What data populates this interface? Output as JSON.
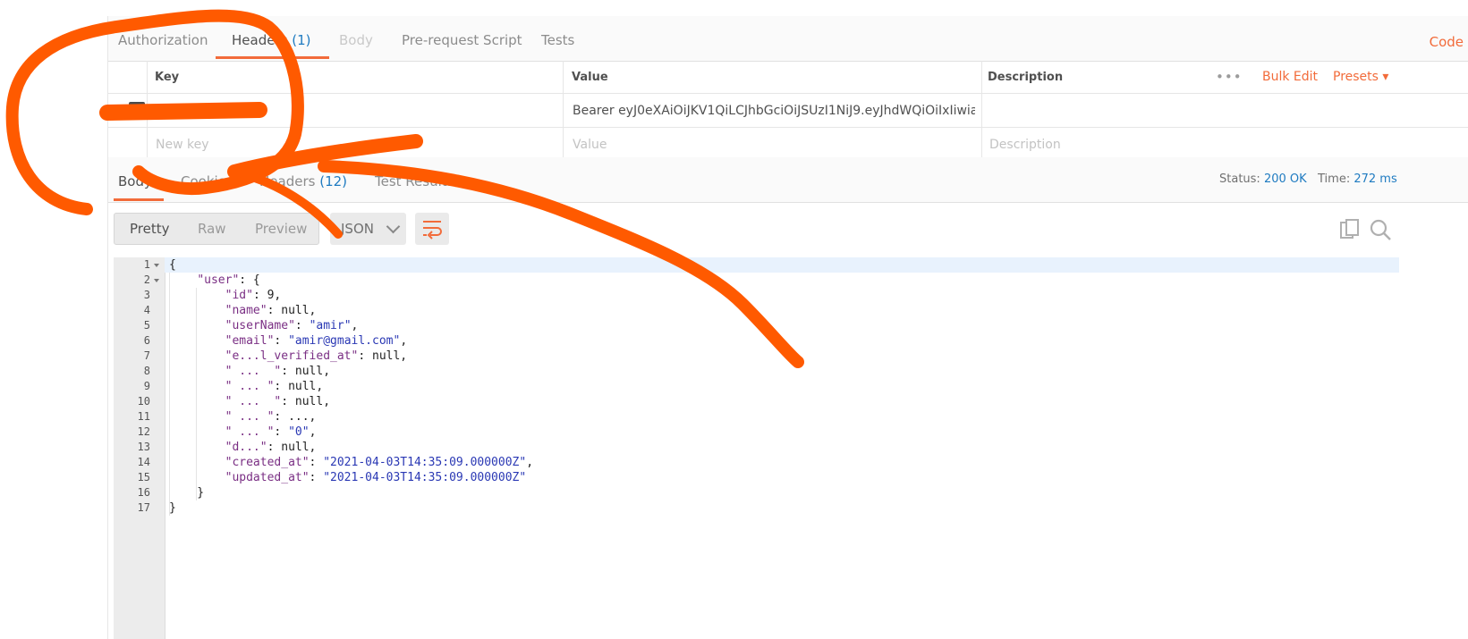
{
  "request_tabs": [
    {
      "label": "Authorization"
    },
    {
      "label": "Headers",
      "count": "(1)"
    },
    {
      "label": "Body"
    },
    {
      "label": "Pre-request Script"
    },
    {
      "label": "Tests"
    }
  ],
  "code_link": "Code",
  "headers_table": {
    "columns": {
      "key": "Key",
      "value": "Value",
      "description": "Description"
    },
    "more_menu": "•••",
    "bulk_edit": "Bulk Edit",
    "presets": "Presets ▾",
    "rows": [
      {
        "key": "Authorization",
        "value": "Bearer eyJ0eXAiOiJKV1QiLCJhbGciOiJSUzI1NiJ9.eyJhdWQiOiIxIiwia...",
        "description": "",
        "checked": true
      }
    ],
    "new_row": {
      "key_placeholder": "New key",
      "value_placeholder": "Value",
      "description_placeholder": "Description"
    }
  },
  "response_tabs": [
    {
      "label": "Body"
    },
    {
      "label": "Cookies"
    },
    {
      "label": "Headers",
      "count": "(12)"
    },
    {
      "label": "Test Results"
    }
  ],
  "status": {
    "status_label": "Status:",
    "status_value": "200 OK",
    "time_label": "Time:",
    "time_value": "272 ms"
  },
  "view_modes": [
    "Pretty",
    "Raw",
    "Preview"
  ],
  "format": "JSON",
  "icons": {
    "wrap": "wrap-lines-icon",
    "copy": "copy-icon",
    "search": "search-icon"
  },
  "colors": {
    "accent": "#f26b3a",
    "link_blue": "#1f7bc1",
    "scribble": "#ff5a00"
  },
  "code": {
    "line_numbers": [
      "1",
      "2",
      "3",
      "4",
      "5",
      "6",
      "7",
      "8",
      "9",
      "10",
      "11",
      "12",
      "13",
      "14",
      "15",
      "16",
      "17"
    ],
    "lines": [
      [
        {
          "t": "n",
          "v": "{"
        }
      ],
      [
        {
          "t": "n",
          "v": "    "
        },
        {
          "t": "k",
          "v": "\"user\""
        },
        {
          "t": "n",
          "v": ": {"
        }
      ],
      [
        {
          "t": "n",
          "v": "        "
        },
        {
          "t": "k",
          "v": "\"id\""
        },
        {
          "t": "n",
          "v": ": 9,"
        }
      ],
      [
        {
          "t": "n",
          "v": "        "
        },
        {
          "t": "k",
          "v": "\"name\""
        },
        {
          "t": "n",
          "v": ": null,"
        }
      ],
      [
        {
          "t": "n",
          "v": "        "
        },
        {
          "t": "k",
          "v": "\"userName\""
        },
        {
          "t": "n",
          "v": ": "
        },
        {
          "t": "s",
          "v": "\"amir\""
        },
        {
          "t": "n",
          "v": ","
        }
      ],
      [
        {
          "t": "n",
          "v": "        "
        },
        {
          "t": "k",
          "v": "\"email\""
        },
        {
          "t": "n",
          "v": ": "
        },
        {
          "t": "s",
          "v": "\"amir@gmail.com\""
        },
        {
          "t": "n",
          "v": ","
        }
      ],
      [
        {
          "t": "n",
          "v": "        "
        },
        {
          "t": "k",
          "v": "\"e...l_verified_at\""
        },
        {
          "t": "n",
          "v": ": null,"
        }
      ],
      [
        {
          "t": "n",
          "v": "        "
        },
        {
          "t": "k",
          "v": "\" ...  \""
        },
        {
          "t": "n",
          "v": ": null,"
        }
      ],
      [
        {
          "t": "n",
          "v": "        "
        },
        {
          "t": "k",
          "v": "\" ... \""
        },
        {
          "t": "n",
          "v": ": null,"
        }
      ],
      [
        {
          "t": "n",
          "v": "        "
        },
        {
          "t": "k",
          "v": "\" ...  \""
        },
        {
          "t": "n",
          "v": ": null,"
        }
      ],
      [
        {
          "t": "n",
          "v": "        "
        },
        {
          "t": "k",
          "v": "\" ... \""
        },
        {
          "t": "n",
          "v": ": ...,"
        }
      ],
      [
        {
          "t": "n",
          "v": "        "
        },
        {
          "t": "k",
          "v": "\" ... \""
        },
        {
          "t": "n",
          "v": ": "
        },
        {
          "t": "s",
          "v": "\"0\""
        },
        {
          "t": "n",
          "v": ","
        }
      ],
      [
        {
          "t": "n",
          "v": "        "
        },
        {
          "t": "k",
          "v": "\"d...\""
        },
        {
          "t": "n",
          "v": ": null,"
        }
      ],
      [
        {
          "t": "n",
          "v": "        "
        },
        {
          "t": "k",
          "v": "\"created_at\""
        },
        {
          "t": "n",
          "v": ": "
        },
        {
          "t": "s",
          "v": "\"2021-04-03T14:35:09.000000Z\""
        },
        {
          "t": "n",
          "v": ","
        }
      ],
      [
        {
          "t": "n",
          "v": "        "
        },
        {
          "t": "k",
          "v": "\"updated_at\""
        },
        {
          "t": "n",
          "v": ": "
        },
        {
          "t": "s",
          "v": "\"2021-04-03T14:35:09.000000Z\""
        }
      ],
      [
        {
          "t": "n",
          "v": "    }"
        }
      ],
      [
        {
          "t": "n",
          "v": "}"
        }
      ]
    ]
  }
}
